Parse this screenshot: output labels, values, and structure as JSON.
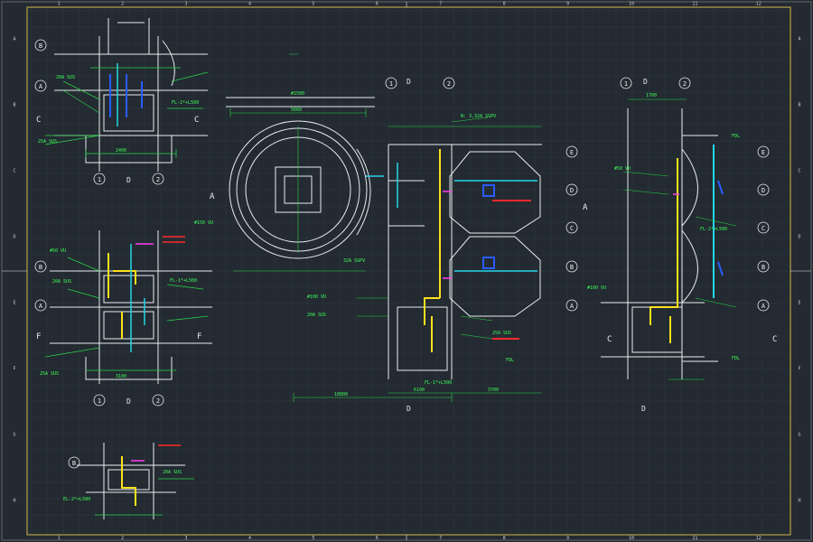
{
  "sheet": {
    "background": "#232a31",
    "grid_color": "#2f3942",
    "frame_color": "#d7b84a",
    "col_labels": [
      "1",
      "2",
      "3",
      "4",
      "5",
      "6",
      "7",
      "8",
      "9",
      "10",
      "11",
      "12"
    ],
    "row_labels": [
      "A",
      "B",
      "C",
      "D",
      "E",
      "F",
      "G",
      "H"
    ]
  },
  "colors": {
    "wall": "#e8ecef",
    "dim": "#2bd44a",
    "pipe_yellow": "#ffe11a",
    "pipe_cyan": "#24d6e8",
    "blue": "#2a5cff",
    "magenta": "#ff3df2",
    "red": "#ff2a2a",
    "green_text": "#3dff5a"
  },
  "axes": {
    "grid_1": "1",
    "grid_2": "2",
    "grid_A": "A",
    "grid_B": "B",
    "grid_C": "C",
    "grid_D": "D",
    "grid_E": "E",
    "grid_F": "F",
    "sec_C": "C",
    "sec_D": "D",
    "sec_A": "A",
    "sec_F": "F"
  },
  "dims": {
    "top_width": "#1500",
    "tank_dia": "5660",
    "bottom_total": "10000",
    "bottom_mid": "6100",
    "bottom_right": "3700",
    "small_a": "2400",
    "small_b": "3100",
    "small_c": "2400",
    "small_d": "2700",
    "small_e": "3700",
    "right_top": "1700"
  },
  "notes": {
    "pipe_a": "20A SUS",
    "pipe_b": "25A SUS",
    "pipe_c": "32A SGPV",
    "pipe_d": "#100 VU",
    "pipe_e": "#50 VU",
    "level_a": "FL-2*+L500",
    "level_b": "FL-1*+L500",
    "level_c": "EL-2*+L500",
    "fl_mark": "FDL",
    "eq_note": "N: 3,32A SGPV",
    "vent": "#150 VU",
    "tag_a": "20A SUS",
    "tag_b": "25A SUS"
  }
}
